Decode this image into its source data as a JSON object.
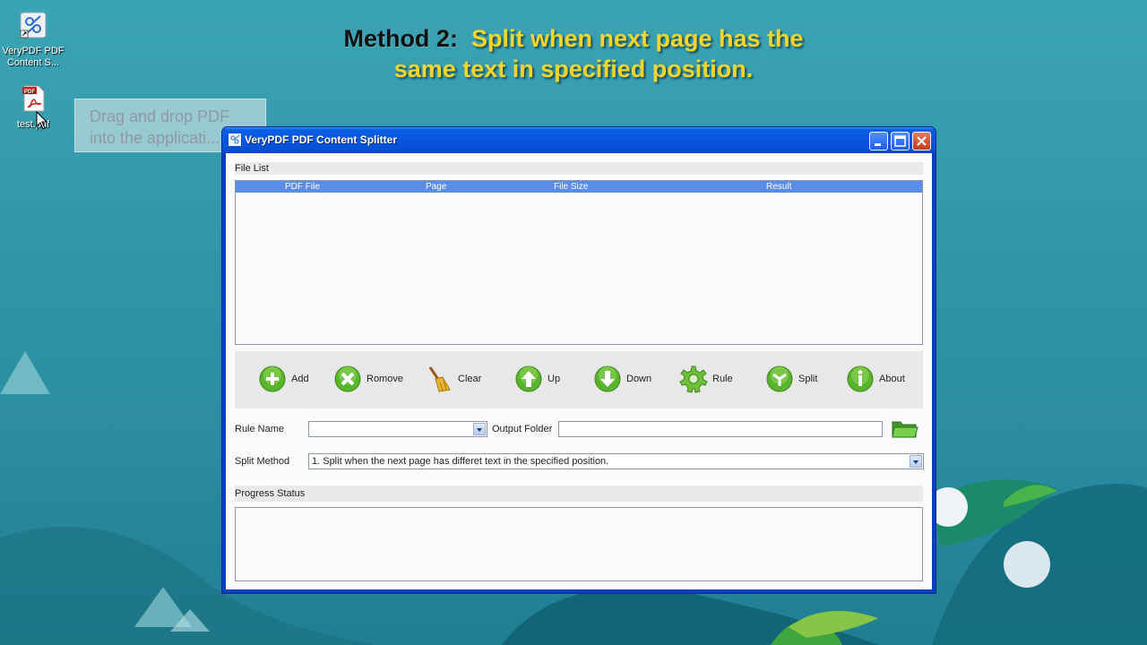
{
  "desktop": {
    "icons": [
      {
        "label": "VeryPDF PDF Content S..."
      },
      {
        "label": "test.pdf"
      }
    ],
    "caption": {
      "method_label": "Method 2:",
      "description": "Split when next page has the\nsame text in specified position."
    },
    "tooltip": "Drag and drop PDF\ninto the applicati..."
  },
  "window": {
    "title": "VeryPDF PDF Content Splitter",
    "file_list": {
      "heading": "File List",
      "columns": [
        "PDF File",
        "Page",
        "File Size",
        "Result"
      ]
    },
    "toolbar": {
      "buttons": [
        {
          "label": "Add",
          "icon": "add-icon"
        },
        {
          "label": "Romove",
          "icon": "remove-icon"
        },
        {
          "label": "Clear",
          "icon": "broom-icon"
        },
        {
          "label": "Up",
          "icon": "arrow-up-icon"
        },
        {
          "label": "Down",
          "icon": "arrow-down-icon"
        },
        {
          "label": "Rule",
          "icon": "gear-icon"
        },
        {
          "label": "Split",
          "icon": "split-icon"
        },
        {
          "label": "About",
          "icon": "info-icon"
        }
      ]
    },
    "rule_name": {
      "label": "Rule Name",
      "value": ""
    },
    "output_folder": {
      "label": "Output Folder",
      "value": ""
    },
    "split_method": {
      "label": "Split Method",
      "value": "1. Split when the next page has differet text in the specified position."
    },
    "progress": {
      "heading": "Progress Status"
    }
  },
  "colors": {
    "caption_yellow": "#f5d52c",
    "header_blue": "#5a8ce8",
    "icon_green": "#58b52b"
  }
}
